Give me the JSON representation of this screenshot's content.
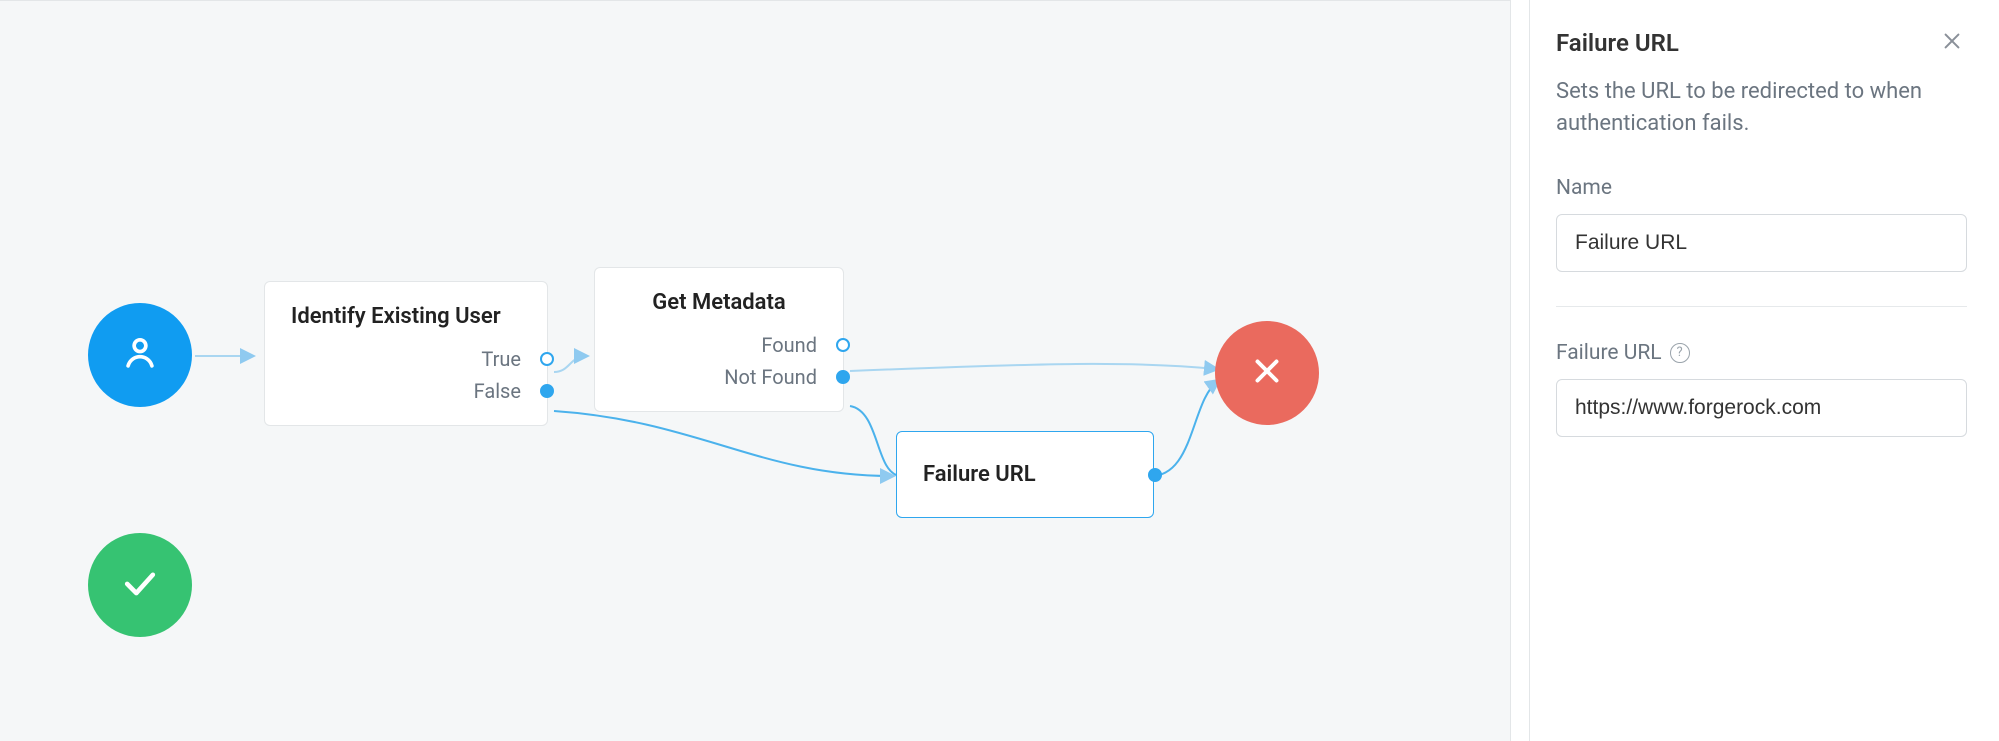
{
  "canvas": {
    "start_node": {
      "type": "user"
    },
    "success_node": {
      "type": "check"
    },
    "fail_node": {
      "type": "x"
    },
    "identify_node": {
      "title": "Identify Existing User",
      "ports": [
        {
          "label": "True"
        },
        {
          "label": "False"
        }
      ]
    },
    "metadata_node": {
      "title": "Get Metadata",
      "ports": [
        {
          "label": "Found"
        },
        {
          "label": "Not Found"
        }
      ]
    },
    "failure_url_node": {
      "title": "Failure URL"
    }
  },
  "panel": {
    "title": "Failure URL",
    "description": "Sets the URL to be redirected to when authentication fails.",
    "name_label": "Name",
    "name_value": "Failure URL",
    "url_label": "Failure URL",
    "url_value": "https://www.forgerock.com"
  }
}
